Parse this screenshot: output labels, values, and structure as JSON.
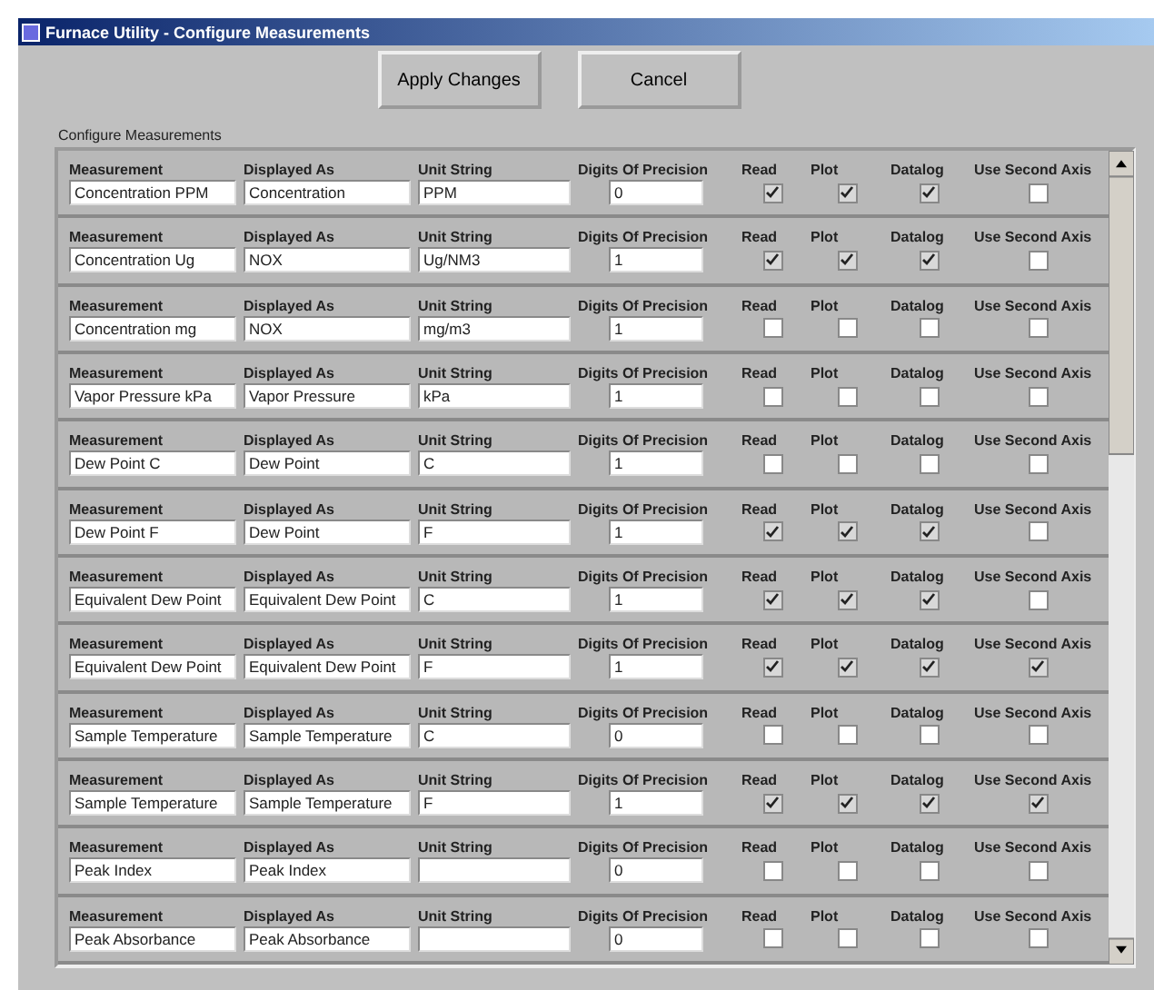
{
  "window": {
    "title": "Furnace Utility - Configure Measurements"
  },
  "buttons": [
    "Apply Changes",
    "Cancel"
  ],
  "group_label": "Configure Measurements",
  "rows": [
    {
      "labels": [
        "Measurement",
        "Displayed As",
        "Unit String",
        "Digits Of Precision",
        "Read",
        "Plot",
        "Datalog",
        "Use Second Axis"
      ],
      "measurement": "Concentration PPM",
      "displayed_as": "Concentration",
      "unit": "PPM",
      "digits": "0",
      "read": true,
      "plot": true,
      "datalog": true,
      "second_axis": false
    },
    {
      "labels": [
        "Measurement",
        "Displayed As",
        "Unit String",
        "Digits Of Precision",
        "Read",
        "Plot",
        "Datalog",
        "Use Second Axis"
      ],
      "measurement": "Concentration Ug",
      "displayed_as": "NOX",
      "unit": "Ug/NM3",
      "digits": "1",
      "read": true,
      "plot": true,
      "datalog": true,
      "second_axis": false
    },
    {
      "labels": [
        "Measurement",
        "Displayed As",
        "Unit String",
        "Digits Of Precision",
        "Read",
        "Plot",
        "Datalog",
        "Use Second Axis"
      ],
      "measurement": "Concentration mg",
      "displayed_as": "NOX",
      "unit": "mg/m3",
      "digits": "1",
      "read": false,
      "plot": false,
      "datalog": false,
      "second_axis": false
    },
    {
      "labels": [
        "Measurement",
        "Displayed As",
        "Unit String",
        "Digits Of Precision",
        "Read",
        "Plot",
        "Datalog",
        "Use Second Axis"
      ],
      "measurement": "Vapor Pressure kPa",
      "displayed_as": "Vapor Pressure",
      "unit": "kPa",
      "digits": "1",
      "read": false,
      "plot": false,
      "datalog": false,
      "second_axis": false
    },
    {
      "labels": [
        "Measurement",
        "Displayed As",
        "Unit String",
        "Digits Of Precision",
        "Read",
        "Plot",
        "Datalog",
        "Use Second Axis"
      ],
      "measurement": "Dew Point C",
      "displayed_as": "Dew Point",
      "unit": "C",
      "digits": "1",
      "read": false,
      "plot": false,
      "datalog": false,
      "second_axis": false
    },
    {
      "labels": [
        "Measurement",
        "Displayed As",
        "Unit String",
        "Digits Of Precision",
        "Read",
        "Plot",
        "Datalog",
        "Use Second Axis"
      ],
      "measurement": "Dew Point F",
      "displayed_as": "Dew Point",
      "unit": "F",
      "digits": "1",
      "read": true,
      "plot": true,
      "datalog": true,
      "second_axis": false
    },
    {
      "labels": [
        "Measurement",
        "Displayed As",
        "Unit String",
        "Digits Of Precision",
        "Read",
        "Plot",
        "Datalog",
        "Use Second Axis"
      ],
      "measurement": "Equivalent Dew Point",
      "displayed_as": "Equivalent Dew Point",
      "unit": "C",
      "digits": "1",
      "read": true,
      "plot": true,
      "datalog": true,
      "second_axis": false
    },
    {
      "labels": [
        "Measurement",
        "Displayed As",
        "Unit String",
        "Digits Of Precision",
        "Read",
        "Plot",
        "Datalog",
        "Use Second Axis"
      ],
      "measurement": "Equivalent Dew Point",
      "displayed_as": "Equivalent Dew Point",
      "unit": "F",
      "digits": "1",
      "read": true,
      "plot": true,
      "datalog": true,
      "second_axis": true
    },
    {
      "labels": [
        "Measurement",
        "Displayed As",
        "Unit String",
        "Digits Of Precision",
        "Read",
        "Plot",
        "Datalog",
        "Use Second Axis"
      ],
      "measurement": "Sample Temperature",
      "displayed_as": "Sample Temperature",
      "unit": "C",
      "digits": "0",
      "read": false,
      "plot": false,
      "datalog": false,
      "second_axis": false
    },
    {
      "labels": [
        "Measurement",
        "Displayed As",
        "Unit String",
        "Digits Of Precision",
        "Read",
        "Plot",
        "Datalog",
        "Use Second Axis"
      ],
      "measurement": "Sample Temperature",
      "displayed_as": "Sample Temperature",
      "unit": "F",
      "digits": "1",
      "read": true,
      "plot": true,
      "datalog": true,
      "second_axis": true
    },
    {
      "labels": [
        "Measurement",
        "Displayed As",
        "Unit String",
        "Digits Of Precision",
        "Read",
        "Plot",
        "Datalog",
        "Use Second Axis"
      ],
      "measurement": "Peak Index",
      "displayed_as": "Peak Index",
      "unit": "",
      "digits": "0",
      "read": false,
      "plot": false,
      "datalog": false,
      "second_axis": false
    },
    {
      "labels": [
        "Measurement",
        "Displayed As",
        "Unit String",
        "Digits Of Precision",
        "Read",
        "Plot",
        "Datalog",
        "Use Second Axis"
      ],
      "measurement": "Peak Absorbance",
      "displayed_as": "Peak Absorbance",
      "unit": "",
      "digits": "0",
      "read": false,
      "plot": false,
      "datalog": false,
      "second_axis": false
    }
  ]
}
